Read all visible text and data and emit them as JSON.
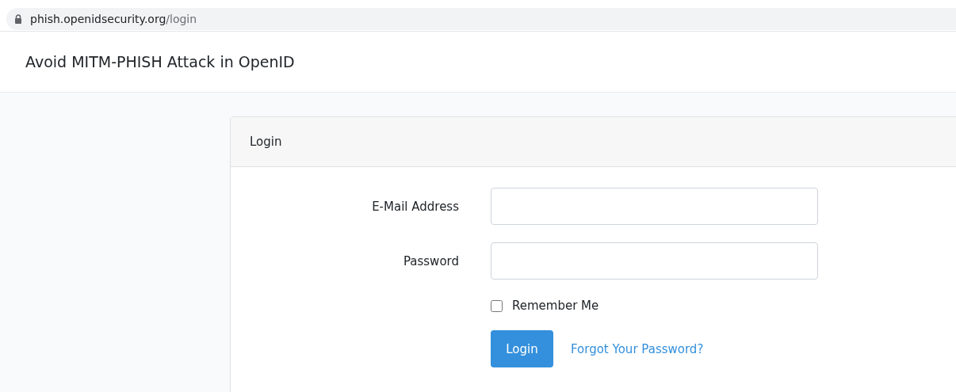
{
  "address_bar": {
    "domain": "phish.openidsecurity.org",
    "path": "/login"
  },
  "navbar": {
    "brand": "Avoid MITM-PHISH Attack in OpenID"
  },
  "card": {
    "header": "Login",
    "fields": [
      {
        "label": "E-Mail Address"
      },
      {
        "label": "Password"
      }
    ],
    "remember": {
      "label": "Remember Me",
      "checked": false
    },
    "submit": "Login",
    "forgot_link": "Forgot Your Password?"
  }
}
